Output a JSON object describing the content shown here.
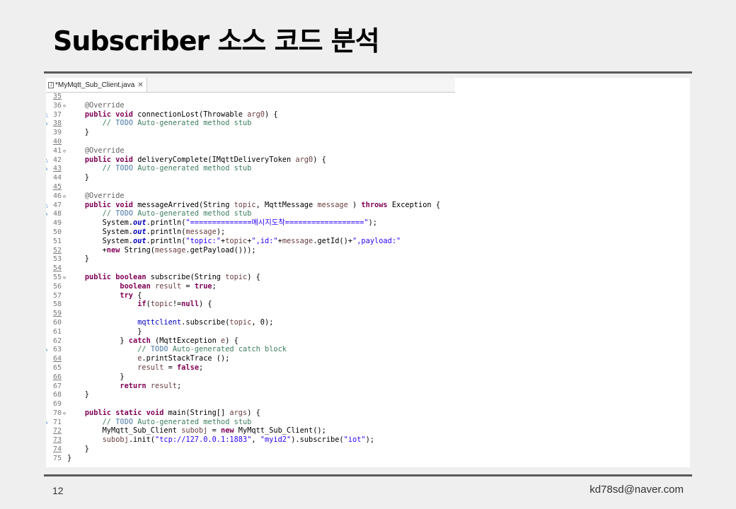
{
  "slide": {
    "title": "Subscriber 소스 코드 분석",
    "page_number": "12",
    "author_email": "kd78sd@naver.com"
  },
  "editor": {
    "tab_label": "*MyMqtt_Sub_Client.java",
    "tab_close": "✕",
    "lines": [
      {
        "n": "35",
        "u": true,
        "tokens": []
      },
      {
        "n": "36",
        "fold": "⊖",
        "tokens": [
          [
            "",
            "    "
          ],
          [
            "ann",
            "@Override"
          ]
        ]
      },
      {
        "n": "37",
        "mark": "△",
        "tokens": [
          [
            "",
            "    "
          ],
          [
            "kw",
            "public void"
          ],
          [
            "",
            " connectionLost(Throwable "
          ],
          [
            "prm",
            "arg0"
          ],
          [
            "",
            ") {"
          ]
        ]
      },
      {
        "n": "38",
        "u": true,
        "mark": "✎",
        "tokens": [
          [
            "",
            "        "
          ],
          [
            "cm",
            "// "
          ],
          [
            "todo",
            "TODO"
          ],
          [
            "cm",
            " Auto-generated method stub"
          ]
        ]
      },
      {
        "n": "39",
        "tokens": [
          [
            "",
            "    }"
          ]
        ]
      },
      {
        "n": "40",
        "u": true,
        "tokens": []
      },
      {
        "n": "41",
        "fold": "⊖",
        "tokens": [
          [
            "",
            "    "
          ],
          [
            "ann",
            "@Override"
          ]
        ]
      },
      {
        "n": "42",
        "mark": "△",
        "tokens": [
          [
            "",
            "    "
          ],
          [
            "kw",
            "public void"
          ],
          [
            "",
            " deliveryComplete(IMqttDeliveryToken "
          ],
          [
            "prm",
            "arg0"
          ],
          [
            "",
            ") {"
          ]
        ]
      },
      {
        "n": "43",
        "u": true,
        "mark": "✎",
        "tokens": [
          [
            "",
            "        "
          ],
          [
            "cm",
            "// "
          ],
          [
            "todo",
            "TODO"
          ],
          [
            "cm",
            " Auto-generated method stub"
          ]
        ]
      },
      {
        "n": "44",
        "tokens": [
          [
            "",
            "    }"
          ]
        ]
      },
      {
        "n": "45",
        "u": true,
        "tokens": []
      },
      {
        "n": "46",
        "fold": "⊖",
        "tokens": [
          [
            "",
            "    "
          ],
          [
            "ann",
            "@Override"
          ]
        ]
      },
      {
        "n": "47",
        "mark": "△",
        "tokens": [
          [
            "",
            "    "
          ],
          [
            "kw",
            "public void"
          ],
          [
            "",
            " messageArrived(String "
          ],
          [
            "prm",
            "topic"
          ],
          [
            "",
            ", MqttMessage "
          ],
          [
            "prm",
            "message"
          ],
          [
            "",
            " ) "
          ],
          [
            "kw",
            "throws"
          ],
          [
            "",
            " Exception {"
          ]
        ]
      },
      {
        "n": "48",
        "mark": "✎",
        "tokens": [
          [
            "",
            "        "
          ],
          [
            "cm",
            "// "
          ],
          [
            "todo",
            "TODO"
          ],
          [
            "cm",
            " Auto-generated method stub"
          ]
        ]
      },
      {
        "n": "49",
        "tokens": [
          [
            "",
            "        System."
          ],
          [
            "sfld",
            "out"
          ],
          [
            "",
            ".println("
          ],
          [
            "str",
            "\"==============메시지도착==================\""
          ],
          [
            "",
            ");"
          ]
        ]
      },
      {
        "n": "50",
        "tokens": [
          [
            "",
            "        System."
          ],
          [
            "sfld",
            "out"
          ],
          [
            "",
            ".println("
          ],
          [
            "prm",
            "message"
          ],
          [
            "",
            ");"
          ]
        ]
      },
      {
        "n": "51",
        "tokens": [
          [
            "",
            "        System."
          ],
          [
            "sfld",
            "out"
          ],
          [
            "",
            ".println("
          ],
          [
            "str",
            "\"topic:\""
          ],
          [
            "",
            "+"
          ],
          [
            "prm",
            "topic"
          ],
          [
            "",
            "+"
          ],
          [
            "str",
            "\",id:\""
          ],
          [
            "",
            "+"
          ],
          [
            "prm",
            "message"
          ],
          [
            "",
            ".getId()+"
          ],
          [
            "str",
            "\",payload:\""
          ]
        ]
      },
      {
        "n": "52",
        "u": true,
        "tokens": [
          [
            "",
            "        +"
          ],
          [
            "kw",
            "new"
          ],
          [
            "",
            " String("
          ],
          [
            "prm",
            "message"
          ],
          [
            "",
            ".getPayload()));"
          ]
        ]
      },
      {
        "n": "53",
        "tokens": [
          [
            "",
            "    }"
          ]
        ]
      },
      {
        "n": "54",
        "u": true,
        "tokens": []
      },
      {
        "n": "55",
        "fold": "⊖",
        "tokens": [
          [
            "",
            "    "
          ],
          [
            "kw",
            "public boolean"
          ],
          [
            "",
            " subscribe(String "
          ],
          [
            "prm",
            "topic"
          ],
          [
            "",
            ") {"
          ]
        ]
      },
      {
        "n": "56",
        "tokens": [
          [
            "",
            "            "
          ],
          [
            "kw",
            "boolean"
          ],
          [
            "",
            " "
          ],
          [
            "prm",
            "result"
          ],
          [
            "",
            " = "
          ],
          [
            "kw",
            "true"
          ],
          [
            "",
            ";"
          ]
        ]
      },
      {
        "n": "57",
        "tokens": [
          [
            "",
            "            "
          ],
          [
            "kw",
            "try"
          ],
          [
            "",
            " {"
          ]
        ]
      },
      {
        "n": "58",
        "tokens": [
          [
            "",
            "                "
          ],
          [
            "kw",
            "if"
          ],
          [
            "",
            "("
          ],
          [
            "prm",
            "topic"
          ],
          [
            "",
            "!="
          ],
          [
            "kw",
            "null"
          ],
          [
            "",
            ") {"
          ]
        ]
      },
      {
        "n": "59",
        "u": true,
        "tokens": []
      },
      {
        "n": "60",
        "tokens": [
          [
            "",
            "                "
          ],
          [
            "fld",
            "mqttclient"
          ],
          [
            "",
            ".subscribe("
          ],
          [
            "prm",
            "topic"
          ],
          [
            "",
            ", 0);"
          ]
        ]
      },
      {
        "n": "61",
        "tokens": [
          [
            "",
            "                }"
          ]
        ]
      },
      {
        "n": "62",
        "tokens": [
          [
            "",
            "            } "
          ],
          [
            "kw",
            "catch"
          ],
          [
            "",
            " (MqttException "
          ],
          [
            "prm",
            "e"
          ],
          [
            "",
            ") {"
          ]
        ]
      },
      {
        "n": "63",
        "mark": "✎",
        "tokens": [
          [
            "",
            "                "
          ],
          [
            "cm",
            "// "
          ],
          [
            "todo",
            "TODO"
          ],
          [
            "cm",
            " Auto-generated catch block"
          ]
        ]
      },
      {
        "n": "64",
        "u": true,
        "tokens": [
          [
            "",
            "                "
          ],
          [
            "prm",
            "e"
          ],
          [
            "",
            ".printStackTrace ();"
          ]
        ]
      },
      {
        "n": "65",
        "tokens": [
          [
            "",
            "                "
          ],
          [
            "prm",
            "result"
          ],
          [
            "",
            " = "
          ],
          [
            "kw",
            "false"
          ],
          [
            "",
            ";"
          ]
        ]
      },
      {
        "n": "66",
        "u": true,
        "tokens": [
          [
            "",
            "            }"
          ]
        ]
      },
      {
        "n": "67",
        "tokens": [
          [
            "",
            "            "
          ],
          [
            "kw",
            "return"
          ],
          [
            "",
            " "
          ],
          [
            "prm",
            "result"
          ],
          [
            "",
            ";"
          ]
        ]
      },
      {
        "n": "68",
        "tokens": [
          [
            "",
            "    }"
          ]
        ]
      },
      {
        "n": "69",
        "tokens": []
      },
      {
        "n": "70",
        "fold": "⊖",
        "tokens": [
          [
            "",
            "    "
          ],
          [
            "kw",
            "public static void"
          ],
          [
            "",
            " main(String[] "
          ],
          [
            "prm",
            "args"
          ],
          [
            "",
            ") {"
          ]
        ]
      },
      {
        "n": "71",
        "mark": "✎",
        "tokens": [
          [
            "",
            "        "
          ],
          [
            "cm",
            "// "
          ],
          [
            "todo",
            "TODO"
          ],
          [
            "cm",
            " Auto-generated method stub"
          ]
        ]
      },
      {
        "n": "72",
        "u": true,
        "tokens": [
          [
            "",
            "        MyMqtt_Sub_Client "
          ],
          [
            "prm",
            "subobj"
          ],
          [
            "",
            " = "
          ],
          [
            "kw",
            "new"
          ],
          [
            "",
            " MyMqtt_Sub_Client();"
          ]
        ]
      },
      {
        "n": "73",
        "u": true,
        "tokens": [
          [
            "",
            "        "
          ],
          [
            "prm",
            "subobj"
          ],
          [
            "",
            ".init("
          ],
          [
            "str",
            "\"tcp://127.0.0.1:1883\""
          ],
          [
            "",
            ", "
          ],
          [
            "str",
            "\"myid2\""
          ],
          [
            "",
            ").subscribe("
          ],
          [
            "str",
            "\"iot\""
          ],
          [
            "",
            ");"
          ]
        ]
      },
      {
        "n": "74",
        "u": true,
        "tokens": [
          [
            "",
            "    }"
          ]
        ]
      },
      {
        "n": "75",
        "tokens": [
          [
            "",
            "}"
          ]
        ]
      }
    ]
  },
  "icons": {
    "file": "java-file-icon",
    "close": "close-icon",
    "fold": "fold-collapse-icon",
    "override": "override-marker-icon",
    "task": "task-marker-icon"
  },
  "colors": {
    "keyword": "#7f0055",
    "comment": "#3f7f5f",
    "string": "#2a00ff",
    "annotation": "#646464",
    "field": "#0000c0",
    "variable": "#6a3e3e"
  }
}
